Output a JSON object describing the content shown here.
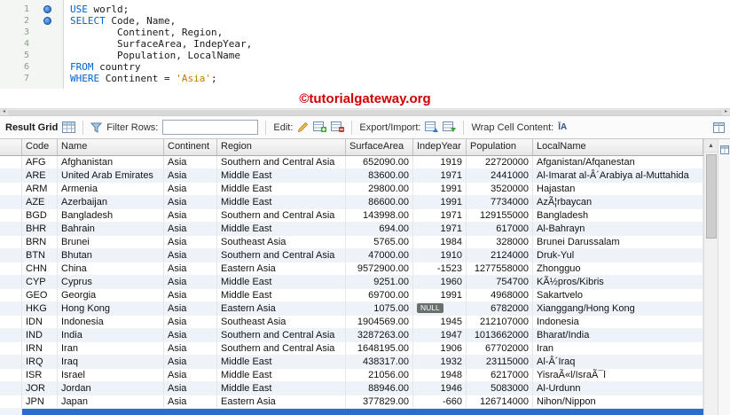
{
  "editor": {
    "lines": [
      {
        "num": "1",
        "marker": true,
        "code": [
          [
            "kw",
            "USE"
          ],
          [
            "pl",
            " world;"
          ]
        ]
      },
      {
        "num": "2",
        "marker": true,
        "code": [
          [
            "kw",
            "SELECT"
          ],
          [
            "pl",
            " Code, Name,"
          ]
        ]
      },
      {
        "num": "3",
        "marker": false,
        "code": [
          [
            "pl",
            "        Continent, Region,"
          ]
        ]
      },
      {
        "num": "4",
        "marker": false,
        "code": [
          [
            "pl",
            "        SurfaceArea, IndepYear,"
          ]
        ]
      },
      {
        "num": "5",
        "marker": false,
        "code": [
          [
            "pl",
            "        Population, LocalName"
          ]
        ]
      },
      {
        "num": "6",
        "marker": false,
        "code": [
          [
            "kw",
            "FROM"
          ],
          [
            "pl",
            " country"
          ]
        ]
      },
      {
        "num": "7",
        "marker": false,
        "code": [
          [
            "kw",
            "WHERE"
          ],
          [
            "pl",
            " Continent = "
          ],
          [
            "str",
            "'Asia'"
          ],
          [
            "pl",
            ";"
          ]
        ]
      }
    ]
  },
  "watermark": "©tutorialgateway.org",
  "scrollbar": {
    "up_arrow": "▲",
    "left_arrow": "◂",
    "right_arrow": "▸"
  },
  "toolbar": {
    "result_grid_label": "Result Grid",
    "filter_label": "Filter Rows:",
    "filter_value": "",
    "edit_label": "Edit:",
    "export_label": "Export/Import:",
    "wrap_label": "Wrap Cell Content:",
    "wrap_icon_text": "ĪA"
  },
  "grid": {
    "columns": [
      "Code",
      "Name",
      "Continent",
      "Region",
      "SurfaceArea",
      "IndepYear",
      "Population",
      "LocalName"
    ],
    "numeric_columns": [
      4,
      5,
      6
    ],
    "null_text": "NULL",
    "partial_row_selected": true,
    "rows": [
      [
        "AFG",
        "Afghanistan",
        "Asia",
        "Southern and Central Asia",
        "652090.00",
        "1919",
        "22720000",
        "Afganistan/Afqanestan"
      ],
      [
        "ARE",
        "United Arab Emirates",
        "Asia",
        "Middle East",
        "83600.00",
        "1971",
        "2441000",
        "Al-Imarat al-Â´Arabiya al-Muttahida"
      ],
      [
        "ARM",
        "Armenia",
        "Asia",
        "Middle East",
        "29800.00",
        "1991",
        "3520000",
        "Hajastan"
      ],
      [
        "AZE",
        "Azerbaijan",
        "Asia",
        "Middle East",
        "86600.00",
        "1991",
        "7734000",
        "AzÃ¦rbaycan"
      ],
      [
        "BGD",
        "Bangladesh",
        "Asia",
        "Southern and Central Asia",
        "143998.00",
        "1971",
        "129155000",
        "Bangladesh"
      ],
      [
        "BHR",
        "Bahrain",
        "Asia",
        "Middle East",
        "694.00",
        "1971",
        "617000",
        "Al-Bahrayn"
      ],
      [
        "BRN",
        "Brunei",
        "Asia",
        "Southeast Asia",
        "5765.00",
        "1984",
        "328000",
        "Brunei Darussalam"
      ],
      [
        "BTN",
        "Bhutan",
        "Asia",
        "Southern and Central Asia",
        "47000.00",
        "1910",
        "2124000",
        "Druk-Yul"
      ],
      [
        "CHN",
        "China",
        "Asia",
        "Eastern Asia",
        "9572900.00",
        "-1523",
        "1277558000",
        "Zhongguo"
      ],
      [
        "CYP",
        "Cyprus",
        "Asia",
        "Middle East",
        "9251.00",
        "1960",
        "754700",
        "KÃ½pros/Kibris"
      ],
      [
        "GEO",
        "Georgia",
        "Asia",
        "Middle East",
        "69700.00",
        "1991",
        "4968000",
        "Sakartvelo"
      ],
      [
        "HKG",
        "Hong Kong",
        "Asia",
        "Eastern Asia",
        "1075.00",
        "NULL",
        "6782000",
        "Xianggang/Hong Kong"
      ],
      [
        "IDN",
        "Indonesia",
        "Asia",
        "Southeast Asia",
        "1904569.00",
        "1945",
        "212107000",
        "Indonesia"
      ],
      [
        "IND",
        "India",
        "Asia",
        "Southern and Central Asia",
        "3287263.00",
        "1947",
        "1013662000",
        "Bharat/India"
      ],
      [
        "IRN",
        "Iran",
        "Asia",
        "Southern and Central Asia",
        "1648195.00",
        "1906",
        "67702000",
        "Iran"
      ],
      [
        "IRQ",
        "Iraq",
        "Asia",
        "Middle East",
        "438317.00",
        "1932",
        "23115000",
        "Al-Â´Iraq"
      ],
      [
        "ISR",
        "Israel",
        "Asia",
        "Middle East",
        "21056.00",
        "1948",
        "6217000",
        "YisraÃ«l/IsraÃ¯l"
      ],
      [
        "JOR",
        "Jordan",
        "Asia",
        "Middle East",
        "88946.00",
        "1946",
        "5083000",
        "Al-Urdunn"
      ],
      [
        "JPN",
        "Japan",
        "Asia",
        "Eastern Asia",
        "377829.00",
        "-660",
        "126714000",
        "Nihon/Nippon"
      ]
    ]
  }
}
